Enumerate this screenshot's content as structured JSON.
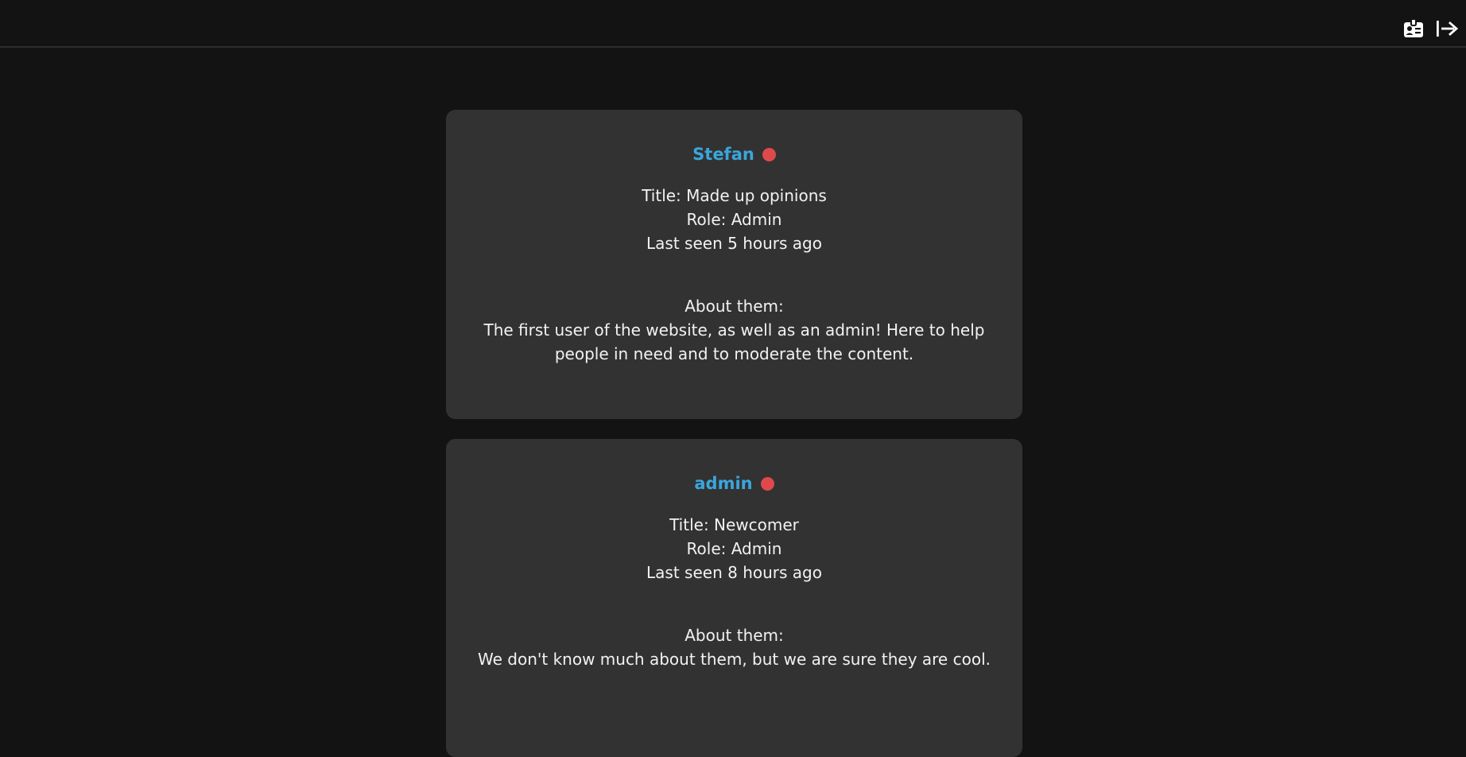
{
  "header": {
    "profile_icon": "id-card-icon",
    "logout_icon": "logout-arrow-icon"
  },
  "colors": {
    "background": "#131313",
    "card": "#323232",
    "username": "#3aa6dc",
    "status_offline": "#e0494b"
  },
  "users": [
    {
      "name": "Stefan",
      "status": "offline",
      "title": "Title: Made up opinions",
      "role": "Role: Admin",
      "last_seen": "Last seen 5 hours ago",
      "about_label": "About them:",
      "about_text": "The first user of the website, as well as an admin! Here to help people in need and to moderate the content."
    },
    {
      "name": "admin",
      "status": "offline",
      "title": "Title: Newcomer",
      "role": "Role: Admin",
      "last_seen": "Last seen 8 hours ago",
      "about_label": "About them:",
      "about_text": "We don't know much about them, but we are sure they are cool."
    }
  ]
}
